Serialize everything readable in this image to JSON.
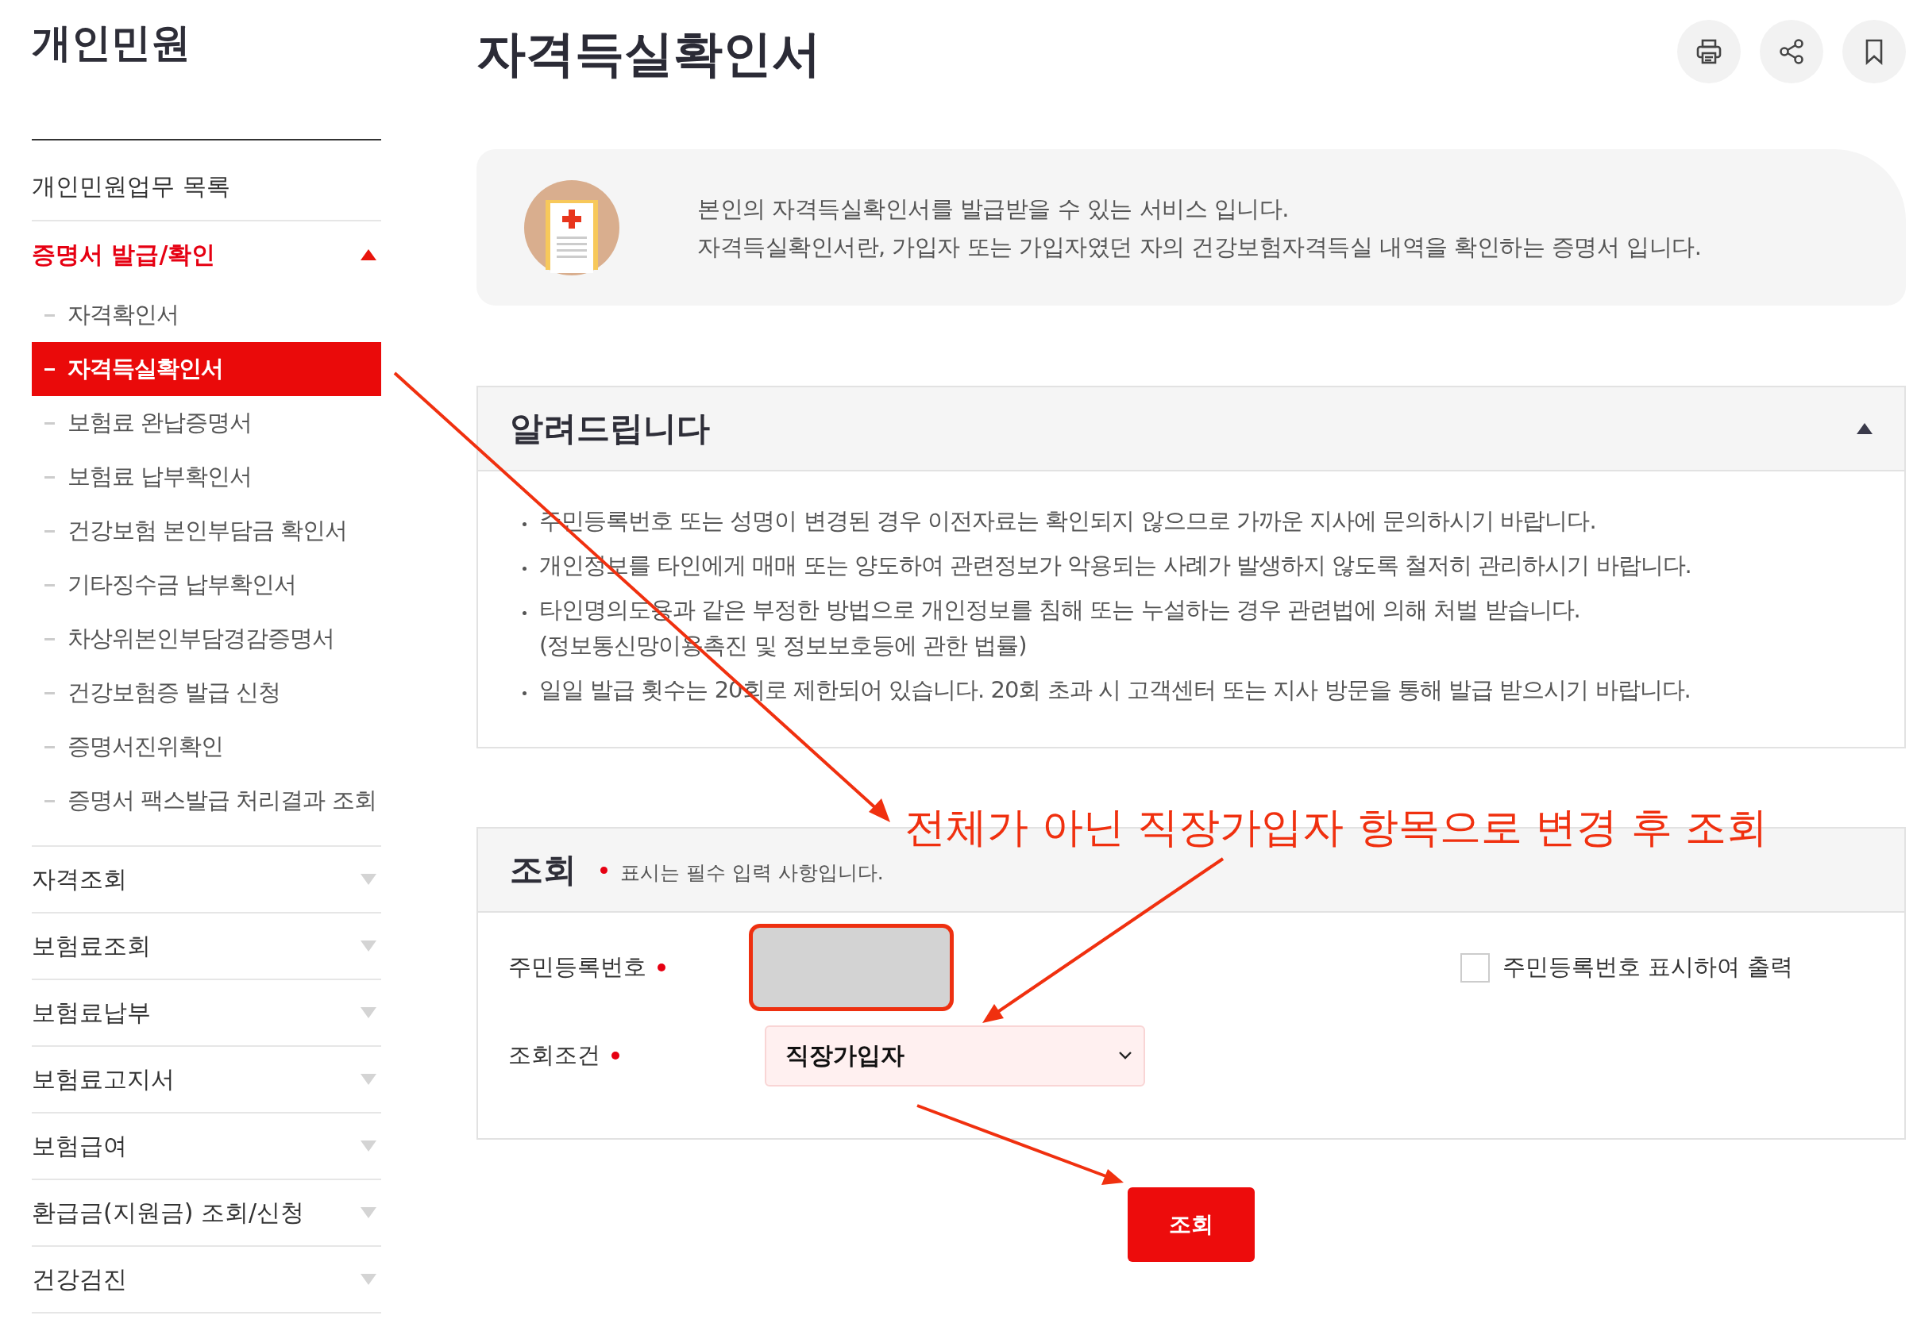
{
  "sidebar": {
    "title": "개인민원",
    "items": [
      {
        "kind": "link",
        "label": "개인민원업무 목록"
      },
      {
        "kind": "group",
        "label": "증명서 발급/확인",
        "expanded": true,
        "children": [
          {
            "label": "자격확인서",
            "selected": false
          },
          {
            "label": "자격득실확인서",
            "selected": true
          },
          {
            "label": "보험료 완납증명서",
            "selected": false
          },
          {
            "label": "보험료 납부확인서",
            "selected": false
          },
          {
            "label": "건강보험 본인부담금 확인서",
            "selected": false
          },
          {
            "label": "기타징수금 납부확인서",
            "selected": false
          },
          {
            "label": "차상위본인부담경감증명서",
            "selected": false
          },
          {
            "label": "건강보험증 발급 신청",
            "selected": false
          },
          {
            "label": "증명서진위확인",
            "selected": false
          },
          {
            "label": "증명서 팩스발급 처리결과 조회",
            "selected": false
          }
        ]
      },
      {
        "kind": "group",
        "label": "자격조회",
        "expanded": false
      },
      {
        "kind": "group",
        "label": "보험료조회",
        "expanded": false
      },
      {
        "kind": "group",
        "label": "보험료납부",
        "expanded": false
      },
      {
        "kind": "group",
        "label": "보험료고지서",
        "expanded": false
      },
      {
        "kind": "group",
        "label": "보험급여",
        "expanded": false
      },
      {
        "kind": "group",
        "label": "환급금(지원금) 조회/신청",
        "expanded": false
      },
      {
        "kind": "group",
        "label": "건강검진",
        "expanded": false
      }
    ]
  },
  "page": {
    "title": "자격득실확인서"
  },
  "intro": {
    "lines": [
      "본인의 자격득실확인서를 발급받을 수 있는 서비스 입니다.",
      "자격득실확인서란, 가입자 또는 가입자였던 자의 건강보험자격득실 내역을 확인하는 증명서 입니다."
    ]
  },
  "notice": {
    "title": "알려드립니다",
    "expanded": true,
    "items": [
      {
        "text": "주민등록번호 또는 성명이 변경된 경우 이전자료는 확인되지 않으므로 가까운 지사에 문의하시기 바랍니다."
      },
      {
        "text": "개인정보를 타인에게 매매 또는 양도하여 관련정보가 악용되는 사례가 발생하지 않도록 철저히 관리하시기 바랍니다."
      },
      {
        "text": "타인명의도용과 같은 부정한 방법으로 개인정보를 침해 또는 누설하는 경우 관련법에 의해 처벌 받습니다.",
        "note": "(정보통신망이용촉진 및 정보보호등에 관한 법률)"
      },
      {
        "text": "일일 발급 횟수는 20회로 제한되어 있습니다. 20회 초과 시 고객센터 또는 지사 방문을 통해 발급 받으시기 바랍니다."
      }
    ]
  },
  "search": {
    "title": "조회",
    "required_note": "표시는 필수 입력 사항입니다.",
    "fields": [
      {
        "kind": "input",
        "label": "주민등록번호",
        "required": true,
        "highlighted": true
      },
      {
        "kind": "select",
        "label": "조회조건",
        "required": true,
        "value": "직장가입자"
      }
    ],
    "checkbox": {
      "label": "주민등록번호 표시하여 출력",
      "checked": false
    },
    "button": "조회"
  },
  "annotation": {
    "text": "전체가 아닌 직장가입자 항목으로 변경 후 조회"
  }
}
